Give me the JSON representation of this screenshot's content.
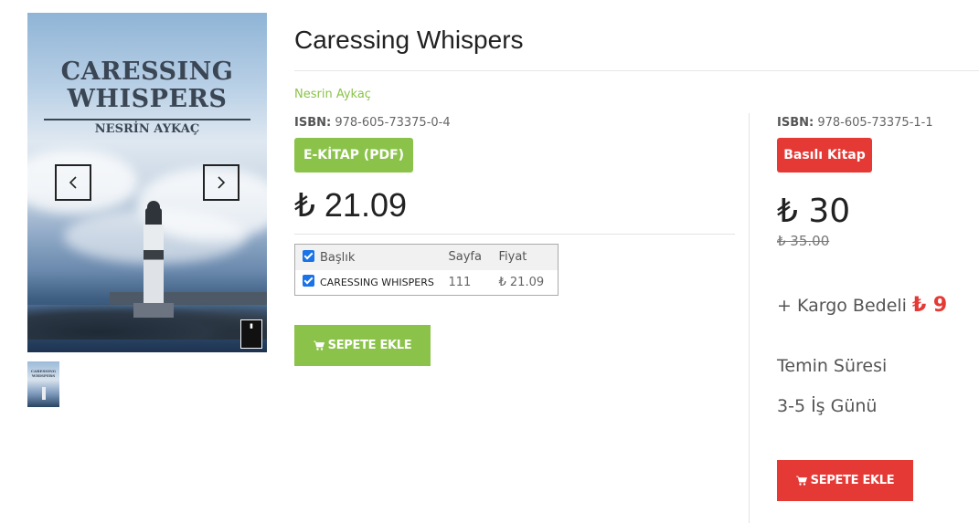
{
  "gallery": {
    "cover_title_line1": "CARESSING",
    "cover_title_line2": "WHISPERS",
    "cover_author": "NESRİN AYKAÇ",
    "prev_icon": "chevron-left-icon",
    "next_icon": "chevron-right-icon"
  },
  "product": {
    "title": "Caressing Whispers",
    "author": "Nesrin Aykaç"
  },
  "ebook": {
    "isbn_label": "ISBN:",
    "isbn": "978-605-73375-0-4",
    "format_label": "E-KİTAP (PDF)",
    "price": "₺ 21.09",
    "table": {
      "headers": [
        "Başlık",
        "Sayfa",
        "Fiyat"
      ],
      "rows": [
        {
          "title": "CARESSING WHISPERS",
          "pages": "111",
          "price": "₺ 21.09"
        }
      ]
    },
    "add_to_cart_label": "SEPETE EKLE",
    "accent_color": "#8bc34a"
  },
  "print": {
    "isbn_label": "ISBN:",
    "isbn": "978-605-73375-1-1",
    "format_label": "Basılı Kitap",
    "price": "₺ 30",
    "old_price": "₺ 35.00",
    "shipping_label": "+ Kargo Bedeli",
    "shipping_amount": "₺ 9",
    "supply_label": "Temin Süresi",
    "supply_value": "3-5 İş Günü",
    "add_to_cart_label": "SEPETE EKLE",
    "accent_color": "#e53935"
  }
}
